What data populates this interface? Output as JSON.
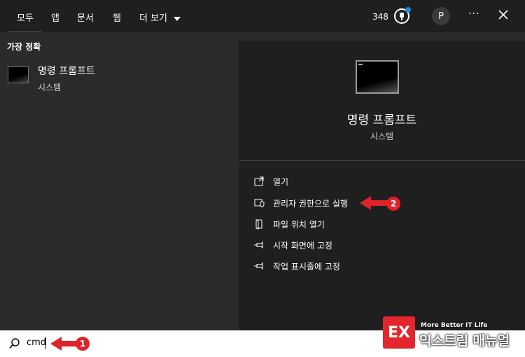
{
  "tabs": [
    {
      "label": "모두"
    },
    {
      "label": "앱"
    },
    {
      "label": "문서"
    },
    {
      "label": "웹"
    },
    {
      "label": "더 보기"
    }
  ],
  "header": {
    "points": "348",
    "avatar_letter": "P",
    "more_label": "···"
  },
  "best_match": {
    "section_title": "가장 정확",
    "title": "명령 프롬프트",
    "subtitle": "시스템"
  },
  "detail": {
    "title": "명령 프롬프트",
    "subtitle": "시스템",
    "actions": [
      {
        "label": "열기",
        "icon": "open-icon"
      },
      {
        "label": "관리자 권한으로 실행",
        "icon": "shield-icon"
      },
      {
        "label": "파일 위치 열기",
        "icon": "file-location-icon"
      },
      {
        "label": "시작 화면에 고정",
        "icon": "pin-icon"
      },
      {
        "label": "작업 표시줄에 고정",
        "icon": "pin-icon"
      }
    ]
  },
  "search": {
    "value": "cmd"
  },
  "annotations": {
    "badge1": "1",
    "badge2": "2"
  },
  "watermark": {
    "logo": "EX",
    "tagline": "More Better IT Life",
    "name": "익스트림 매뉴얼"
  },
  "colors": {
    "accent_red": "#e0222a",
    "notification_blue": "#1e88e5",
    "panel_dark": "#1f1f1f",
    "panel_mid": "#2b2b2b"
  }
}
